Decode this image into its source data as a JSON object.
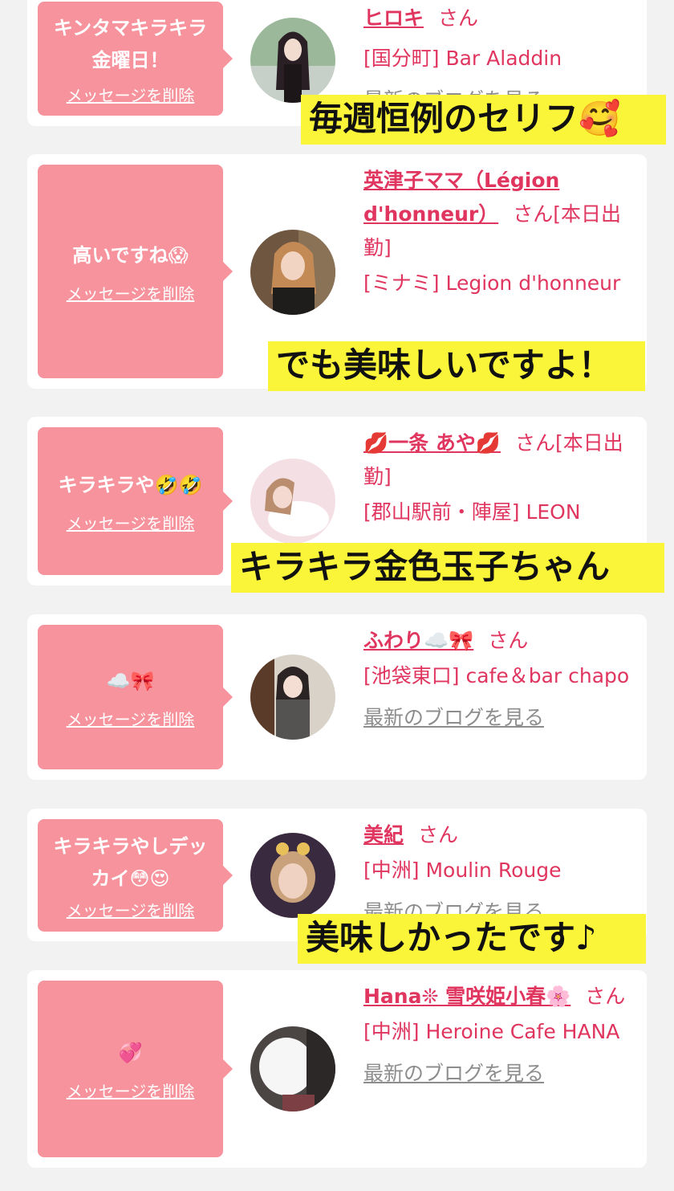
{
  "cards": [
    {
      "message": "キンタマキラキラ金曜日！",
      "delete_label": "メッセージを削除",
      "name": "ヒロキ",
      "honorific": "さん",
      "shop": "[国分町] Bar Aladdin",
      "blog_label": "最新のブログを見る"
    },
    {
      "message": "高いですね😱",
      "delete_label": "メッセージを削除",
      "name": "英津子ママ（Légion d'honneur）",
      "honorific": "さん[本日出勤]",
      "shop": "[ミナミ] Legion d'honneur"
    },
    {
      "message": "キラキラや🤣🤣",
      "delete_label": "メッセージを削除",
      "name": "💋一条 あや💋",
      "honorific": "さん[本日出勤]",
      "shop": "[郡山駅前・陣屋] LEON"
    },
    {
      "message": "☁️🎀",
      "delete_label": "メッセージを削除",
      "name": "ふわり☁️🎀",
      "honorific": "さん",
      "shop": "[池袋東口] cafe＆bar chapo",
      "blog_label": "最新のブログを見る"
    },
    {
      "message": "キラキラやしデッカイ😳😍",
      "delete_label": "メッセージを削除",
      "name": "美紀",
      "honorific": "さん",
      "shop": "[中洲] Moulin Rouge",
      "blog_label": "最新のブログを見る"
    },
    {
      "message": "💞",
      "delete_label": "メッセージを削除",
      "name": "Hana❊ 雪咲姫小春🌸",
      "honorific": "さん",
      "shop": "[中洲] Heroine Cafe HANA",
      "blog_label": "最新のブログを見る"
    }
  ],
  "captions": [
    "毎週恒例のセリフ🥰",
    "でも美味しいですよ！",
    "キラキラ金色玉子ちゃん",
    "美味しかったです♪"
  ],
  "colors": {
    "bubble": "#f7939d",
    "accent": "#e0355f",
    "caption_bg": "#fbf53a",
    "page_bg": "#f2f2f2"
  }
}
